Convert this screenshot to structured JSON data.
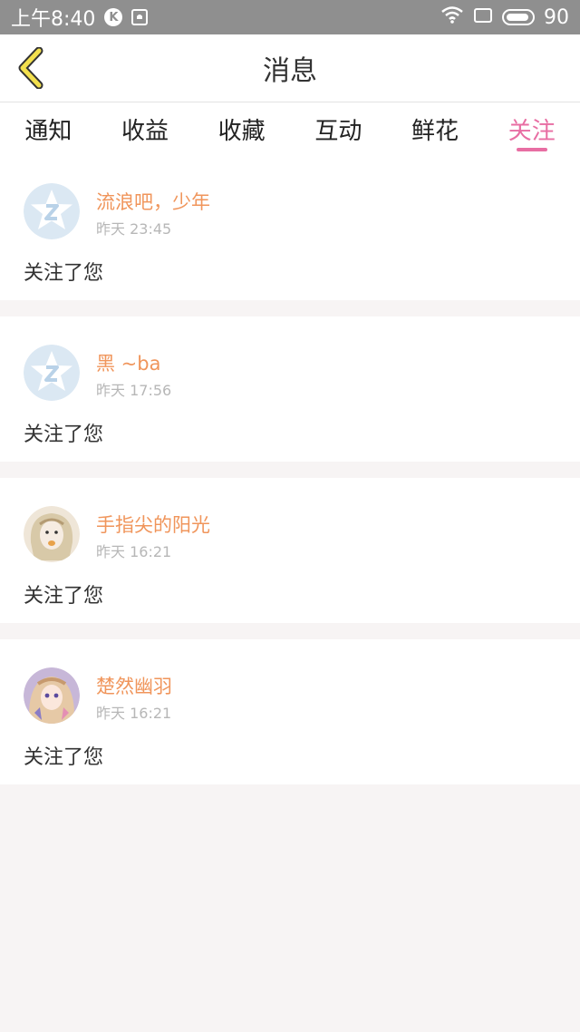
{
  "status_bar": {
    "time": "上午8:40",
    "badge": "K",
    "battery": "90"
  },
  "header": {
    "title": "消息"
  },
  "tabs": [
    {
      "label": "通知",
      "active": false
    },
    {
      "label": "收益",
      "active": false
    },
    {
      "label": "收藏",
      "active": false
    },
    {
      "label": "互动",
      "active": false
    },
    {
      "label": "鲜花",
      "active": false
    },
    {
      "label": "关注",
      "active": true
    }
  ],
  "messages": [
    {
      "username": "流浪吧，少年",
      "time": "昨天 23:45",
      "text": "关注了您",
      "avatar": "qq-default-avatar"
    },
    {
      "username": "黑 ~ba",
      "time": "昨天 17:56",
      "text": "关注了您",
      "avatar": "qq-default-avatar"
    },
    {
      "username": "手指尖的阳光",
      "time": "昨天 16:21",
      "text": "关注了您",
      "avatar": "user-photo-avatar"
    },
    {
      "username": "楚然幽羽",
      "time": "昨天 16:21",
      "text": "关注了您",
      "avatar": "anime-avatar"
    }
  ],
  "colors": {
    "accent": "#e86ea3",
    "username": "#f0955b",
    "status_bar": "#8f8f8f",
    "back_arrow": "#f3e04e"
  }
}
